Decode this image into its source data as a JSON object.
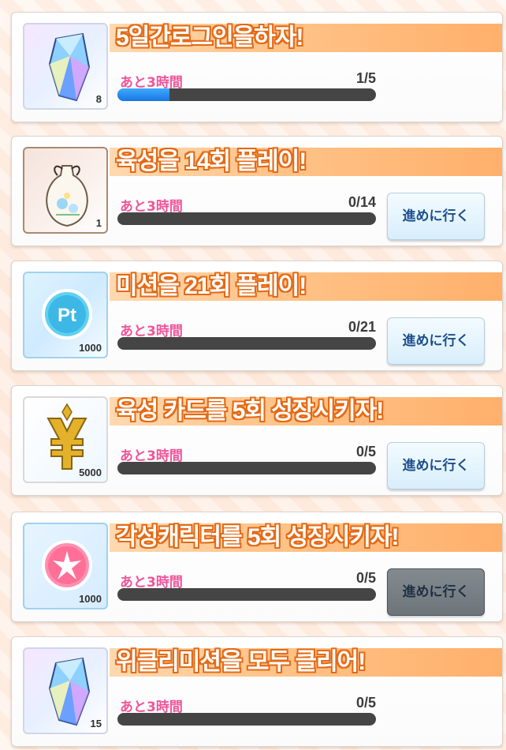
{
  "missions": [
    {
      "title": "5일간로그인을하자!",
      "deadline": "あと3時間",
      "progress": "1/5",
      "progress_fraction": 0.2,
      "reward_icon": "crystal-icon",
      "reward_qty": "8",
      "go_button": null
    },
    {
      "title": "육성을 14회 플레이!",
      "deadline": "あと3時間",
      "progress": "0/14",
      "progress_fraction": 0,
      "reward_icon": "flower-sachet-icon",
      "reward_qty": "1",
      "go_button": "進めに行く"
    },
    {
      "title": "미션을 21회 플레이!",
      "deadline": "あと3時間",
      "progress": "0/21",
      "progress_fraction": 0,
      "reward_icon": "pt-coin-icon",
      "reward_qty": "1000",
      "go_button": "進めに行く"
    },
    {
      "title": "육성 카드를 5회 성장시키자!",
      "deadline": "あと3時間",
      "progress": "0/5",
      "progress_fraction": 0,
      "reward_icon": "yen-token-icon",
      "reward_qty": "5000",
      "go_button": "進めに行く"
    },
    {
      "title": "각성캐릭터를 5회 성장시키자!",
      "deadline": "あと3時間",
      "progress": "0/5",
      "progress_fraction": 0,
      "reward_icon": "lily-badge-icon",
      "reward_qty": "1000",
      "go_button": "進めに行く",
      "go_pressed": true
    },
    {
      "title": "위클리미션을 모두 클리어!",
      "deadline": "あと3時間",
      "progress": "0/5",
      "progress_fraction": 0,
      "reward_icon": "crystal-icon",
      "reward_qty": "15",
      "go_button": null
    }
  ],
  "colors": {
    "title_outline": "#e46a16",
    "deadline_text": "#f0559a",
    "bar_track": "#454545",
    "bar_fill": "#1777e0",
    "button_text": "#1d4e8c"
  }
}
